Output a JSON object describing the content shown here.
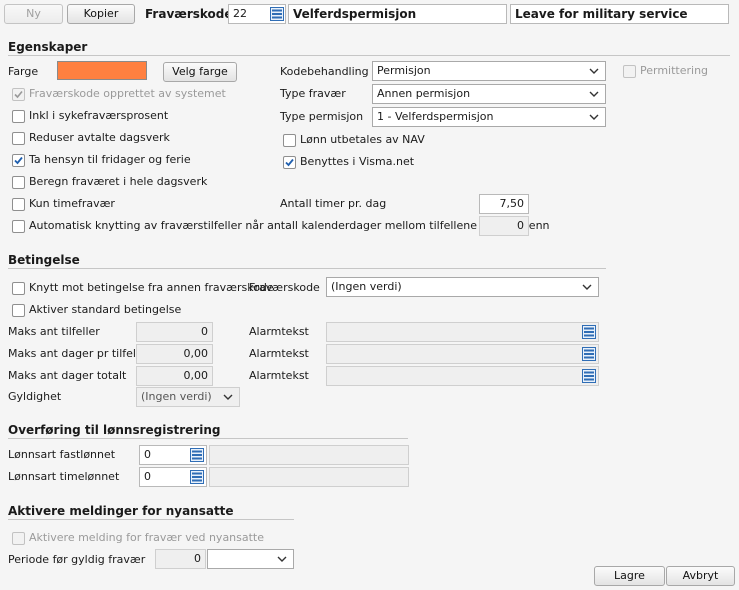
{
  "toolbar": {
    "new_label": "Ny",
    "copy_label": "Kopier",
    "code_label": "Fraværskode",
    "code_value": "22",
    "name_no": "Velferdspermisjon",
    "name_en": "Leave for military service"
  },
  "properties": {
    "title": "Egenskaper",
    "color_label": "Farge",
    "color_value": "#ff8040",
    "choose_color_label": "Velg farge",
    "system_created_label": "Fraværskode opprettet av systemet",
    "sick_leave_label": "Inkl i sykefraværsprosent",
    "reduce_days_label": "Reduser avtalte dagsverk",
    "holidays_label": "Ta hensyn til fridager og ferie",
    "whole_days_label": "Beregn fraværet i hele dagsverk",
    "hourly_only_label": "Kun timefravær",
    "hours_per_day_label": "Antall timer pr. dag",
    "hours_per_day_value": "7,50",
    "auto_link_label": "Automatisk knytting av fraværstilfeller når antall kalenderdager mellom tilfellene er færre enn",
    "auto_link_value": "0",
    "code_handling_label": "Kodebehandling",
    "code_handling_value": "Permisjon",
    "absence_type_label": "Type fravær",
    "absence_type_value": "Annen permisjon",
    "leave_type_label": "Type permisjon",
    "leave_type_value": "1 - Velferdspermisjon",
    "layoff_label": "Permittering",
    "nav_salary_label": "Lønn utbetales av NAV",
    "visma_label": "Benyttes i Visma.net",
    "checked": {
      "system_created": true,
      "sick_leave": false,
      "reduce_days": false,
      "holidays": true,
      "whole_days": false,
      "hourly_only": false,
      "auto_link": false,
      "layoff": false,
      "nav_salary": false,
      "visma": true
    }
  },
  "condition": {
    "title": "Betingelse",
    "link_label": "Knytt mot betingelse fra annen fraværskode",
    "absence_code_label": "Fraværskode",
    "absence_code_value": "(Ingen verdi)",
    "standard_label": "Aktiver standard betingelse",
    "max_cases_label": "Maks ant tilfeller",
    "max_cases_value": "0",
    "max_days_case_label": "Maks ant dager pr tilfelle",
    "max_days_case_value": "0,00",
    "max_days_total_label": "Maks ant dager totalt",
    "max_days_total_value": "0,00",
    "alarm_label": "Alarmtekst",
    "validity_label": "Gyldighet",
    "validity_value": "(Ingen verdi)"
  },
  "transfer": {
    "title": "Overføring til lønnsregistrering",
    "fixed_label": "Lønnsart fastlønnet",
    "fixed_value": "0",
    "hourly_label": "Lønnsart timelønnet",
    "hourly_value": "0"
  },
  "new_hires": {
    "title": "Aktivere meldinger for nyansatte",
    "activate_label": "Aktivere melding for fravær ved nyansatte",
    "period_label": "Periode før gyldig fravær",
    "period_value": "0",
    "period_unit": ""
  },
  "footer": {
    "save_label": "Lagre",
    "cancel_label": "Avbryt"
  },
  "icons": {
    "lookup": "list-lookup-icon",
    "dropdown": "chevron-down-icon",
    "check": "checkmark-icon"
  }
}
